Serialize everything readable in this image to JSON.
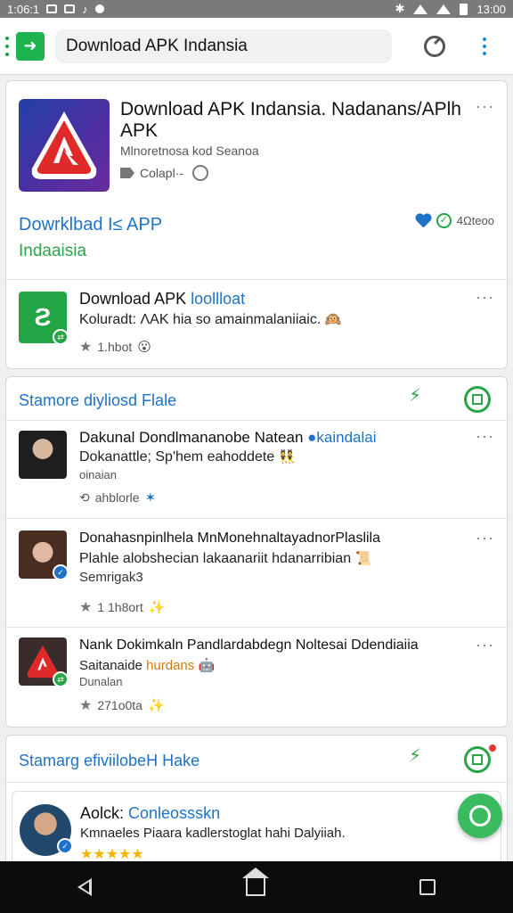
{
  "status_bar": {
    "left_time": "1:06:1",
    "right_time": "13:00"
  },
  "top_bar": {
    "search_value": "Download APK Indansia"
  },
  "hero": {
    "title": "Download APK Indansia. Nadanans/APlh APK",
    "subtitle": "Mlnoretnosa kod Seanoa",
    "meta": "Colapl·-",
    "download_line1": "Dowrklbad I≤ APP",
    "download_line2": "Indaaisia",
    "stats": "4Ωteoo"
  },
  "featured": {
    "title_main": "Download APK ",
    "title_accent": "loollloat",
    "line": "Koluradt: ΛAK hia so amainmalaniiaic.",
    "line_emoji": "🙉",
    "meta": "1.hbot",
    "meta_emoji": "😮"
  },
  "section1": {
    "title": "Stamore diyliosd Flale",
    "items": [
      {
        "title_main": "Dakunal Dondlmananobe Natean ",
        "title_accent": "kaindalai",
        "line": "Dokanattle; Sp'hem eahoddete",
        "line_emoji": "👯",
        "small": "oinaian",
        "meta": "ahblorle"
      },
      {
        "title_main": "Donahasnpinlhela MnMonehnaltayadnorPlaslila",
        "line": "Plahle alobshecian lakaanariit hdanarribian",
        "line_emoji": "📜",
        "small": "Semrigak3",
        "meta": "1 1h8ort",
        "meta_emoji": "✨"
      },
      {
        "title_main": "Nank Dokimkaln Pandlardabdegn Noltesai Ddendiaiia",
        "line_main": "Saitanaide ",
        "line_accent": "hurdans",
        "line_emoji": "🤖",
        "small": "Dunalan",
        "meta": "271o0ta",
        "meta_emoji": "✨"
      }
    ]
  },
  "section2": {
    "title": "Stamarg efiviilobeH Hake",
    "item": {
      "title_main": "Aolck: ",
      "title_accent": "Conleossskn",
      "line": "Kmnaeles Piaara kadlerstoglat hahi Dalyiiah.",
      "rating": "★★★★★"
    }
  },
  "colors": {
    "accent_blue": "#1e73c8",
    "accent_green": "#2aa447"
  }
}
